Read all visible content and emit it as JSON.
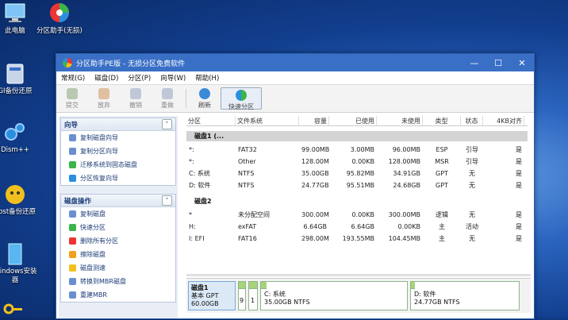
{
  "desktop": {
    "icons": [
      {
        "name": "pc-icon",
        "label": "此电脑"
      },
      {
        "name": "partition-tool-icon",
        "label": "分区助手(无损)"
      },
      {
        "name": "ghost-backup-icon",
        "label": "GI备份还原"
      },
      {
        "name": "dism-icon",
        "label": "Dism++"
      },
      {
        "name": "ghost-restore-icon",
        "label": "host备份还原"
      },
      {
        "name": "windows-install-icon",
        "label": "Windows安装器"
      }
    ]
  },
  "window": {
    "title": "分区助手PE版 - 无损分区免费软件",
    "menu": [
      "常规(G)",
      "磁盘(D)",
      "分区(P)",
      "向导(W)",
      "帮助(H)"
    ],
    "toolbar": [
      "提交",
      "放弃",
      "撤销",
      "重做",
      "刷新",
      "快速分区"
    ],
    "sidebar": {
      "wizard_title": "向导",
      "wizard_items": [
        "复制磁盘向导",
        "复制分区向导",
        "迁移系统到固态磁盘",
        "分区恢复向导"
      ],
      "disk_ops_title": "磁盘操作",
      "disk_ops_items": [
        "复制磁盘",
        "快速分区",
        "删除所有分区",
        "擦除磁盘",
        "磁盘测速",
        "转换到MBR磁盘",
        "重建MBR"
      ]
    },
    "table": {
      "columns": [
        "分区",
        "文件系统",
        "容量",
        "已使用",
        "未使用",
        "类型",
        "状态",
        "4KB对齐"
      ],
      "disk1_label": "磁盘1 (...",
      "disk1_rows": [
        [
          "*:",
          "FAT32",
          "99.00MB",
          "3.00MB",
          "96.00MB",
          "ESP",
          "引导",
          "是"
        ],
        [
          "*:",
          "Other",
          "128.00MB",
          "0.00KB",
          "128.00MB",
          "MSR",
          "引导",
          "是"
        ],
        [
          "C: 系统",
          "NTFS",
          "35.00GB",
          "95.82MB",
          "34.91GB",
          "GPT",
          "无",
          "是"
        ],
        [
          "D: 软件",
          "NTFS",
          "24.77GB",
          "95.51MB",
          "24.68GB",
          "GPT",
          "无",
          "是"
        ]
      ],
      "disk2_label": "磁盘2",
      "disk2_rows": [
        [
          "*",
          "未分配空间",
          "300.00MB",
          "0.00KB",
          "300.00MB",
          "逻辑",
          "无",
          "是"
        ],
        [
          "H:",
          "exFAT",
          "6.64GB",
          "6.64GB",
          "0.00KB",
          "主",
          "活动",
          "是"
        ],
        [
          "I: EFI",
          "FAT16",
          "298.00MB",
          "193.55MB",
          "104.45MB",
          "主",
          "无",
          "是"
        ]
      ]
    },
    "diskmap": {
      "disk_name": "磁盘1",
      "disk_type": "基本 GPT",
      "disk_size": "60.00GB",
      "p1_num": "9",
      "p2_num": "1",
      "c_name": "C: 系统",
      "c_desc": "35.00GB NTFS",
      "d_name": "D: 软件",
      "d_desc": "24.77GB NTFS"
    }
  }
}
